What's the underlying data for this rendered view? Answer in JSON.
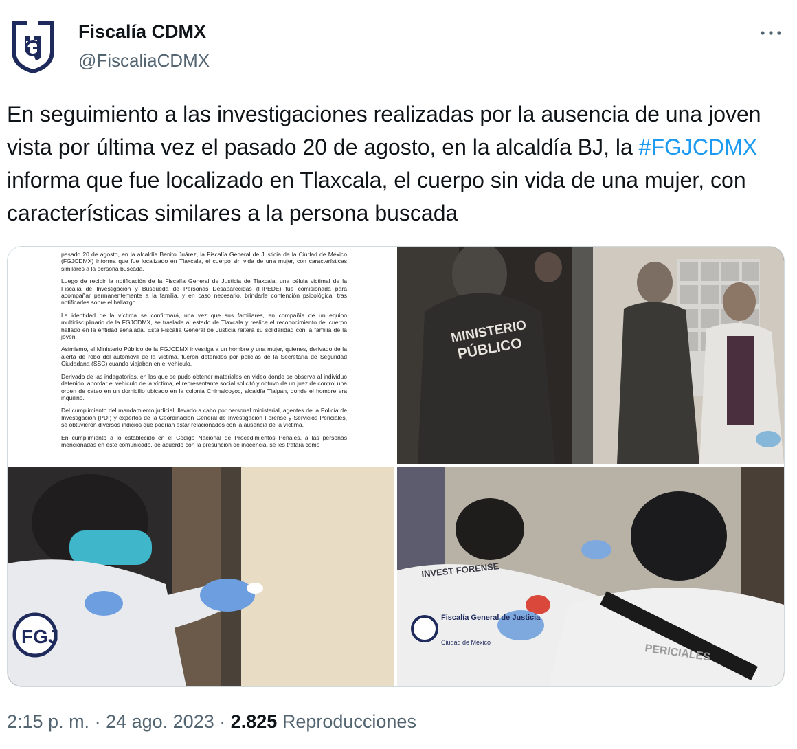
{
  "author": {
    "name": "Fiscalía CDMX",
    "handle": "@FiscaliaCDMX",
    "avatar_icon": "fgj-logo-icon",
    "brand_color": "#1f2a5c"
  },
  "tweet": {
    "text_part1": "En seguimiento a las investigaciones realizadas por la ausencia de una joven vista por última vez el pasado 20 de agosto, en la alcaldía BJ, la ",
    "hashtag": "#FGJCDMX",
    "text_part2": " informa que fue localizado en Tlaxcala, el cuerpo sin vida de una mujer, con características similares a la persona buscada",
    "hashtag_color": "#1d9bf0"
  },
  "media": {
    "document": {
      "paragraphs": [
        "pasado 20 de agosto, en la alcaldía Benito Juárez, la Fiscalía General de Justicia de la Ciudad de México (FGJCDMX) informa que fue localizado en Tlaxcala, el cuerpo sin vida de una mujer, con características similares a la persona buscada.",
        "Luego de recibir la notificación de la Fiscalía General de Justicia de Tlaxcala, una célula victimal de la Fiscalía de Investigación y Búsqueda de Personas Desaparecidas (FIPEDE) fue comisionada para acompañar permanentemente a la familia, y en caso necesario, brindarle contención psicológica, tras notificarles sobre el hallazgo.",
        "La identidad de la víctima se confirmará, una vez que sus familiares, en compañía de un equipo multidisciplinario de la FGJCDMX, se traslade al estado de Tlaxcala y realice el reconocimiento del cuerpo hallado en la entidad señalada. Esta Fiscalía General de Justicia reitera su solidaridad con la familia de la joven.",
        "Asimismo, el Ministerio Público de la FGJCDMX investiga a un hombre y una mujer, quienes, derivado de la alerta de robo del automóvil de la víctima, fueron detenidos por policías de la Secretaría de Seguridad Ciudadana (SSC) cuando viajaban en el vehículo.",
        "Derivado de las indagatorias, en las que se pudo obtener materiales en video donde se observa al individuo detenido, abordar el vehículo de la víctima, el representante social solicitó y obtuvo de un juez de control una orden de cateo en un domicilio ubicado en la colonia Chimalcoyoc, alcaldía Tlalpan, donde el hombre era inquilino.",
        "Del cumplimiento del mandamiento judicial, llevado a cabo por personal ministerial, agentes de la Policía de Investigación (PDI) y expertos de la Coordinación General de Investigación Forense y Servicios Periciales, se obtuvieron diversos indicios que podrían estar relacionados con la ausencia de la víctima.",
        "En cumplimiento a lo establecido en el Código Nacional de Procedimientos Penales, a las personas mencionadas en este comunicado, de acuerdo con la presunción de inocencia, se les tratará como"
      ]
    },
    "photo2": {
      "jacket_line1": "MINISTERIO",
      "jacket_line2": "PÚBLICO"
    },
    "photo3": {
      "logo_text": "FGJ"
    },
    "photo4": {
      "jacket_text1": "INVEST FORENSE",
      "jacket_text2": "Fiscalía General de Justicia",
      "jacket_text3": "Ciudad de México",
      "jacket_text4": "PERICIALES"
    }
  },
  "footer": {
    "time": "2:15 p. m.",
    "separator": " · ",
    "date": "24 ago. 2023",
    "views_count": "2.825",
    "views_label": "Reproducciones"
  }
}
